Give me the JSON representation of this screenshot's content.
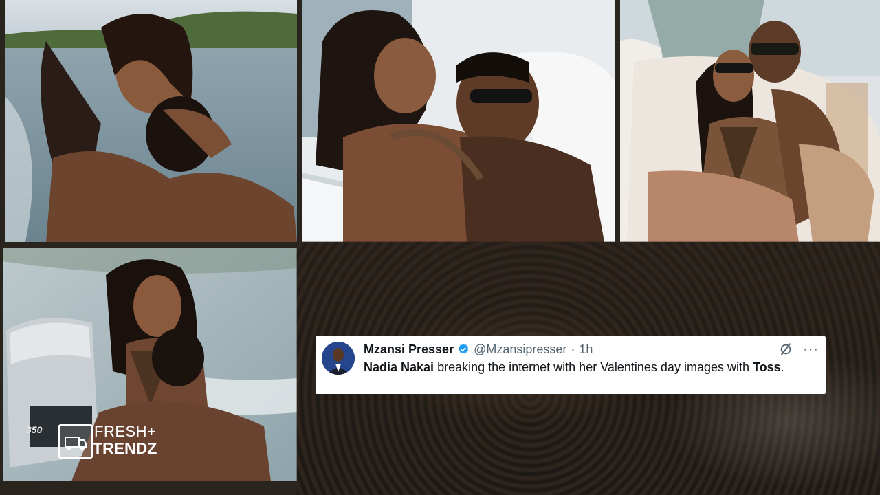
{
  "tweet": {
    "display_name": "Mzansi Presser",
    "handle": "@Mzansipresser",
    "separator": "·",
    "time": "1h",
    "more": "···",
    "text_name": "Nadia Nakai",
    "text_middle": " breaking the internet with her Valentines day images with ",
    "text_name2": "Toss",
    "text_end": "."
  },
  "watermark": {
    "line1": "FRESH",
    "plus": "+",
    "line2": "TRENDZ"
  },
  "engine_badge": "350",
  "colors": {
    "verified": "#1d9bf0",
    "card_bg": "#ffffff",
    "text_primary": "#0f1419",
    "text_secondary": "#536471"
  }
}
